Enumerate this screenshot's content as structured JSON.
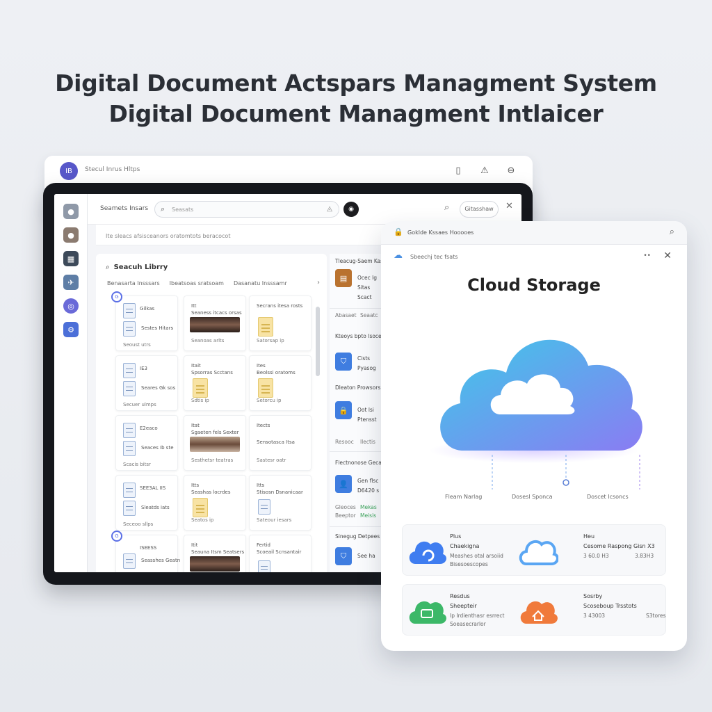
{
  "headline": {
    "line1": "Digital Document Actspars Managment System",
    "line2": "Digital Document Managment Intlaicer"
  },
  "back_window": {
    "title": "Stecul Inrus Hltps",
    "logo_text": "IB",
    "icons": [
      "clipboard-icon",
      "warning-icon",
      "minus-circle-icon"
    ]
  },
  "tablet": {
    "topbar": {
      "label": "Seamets Insars",
      "search_placeholder": "Seasats",
      "button_label": "Gitasshaw"
    },
    "infobar_text": "Ite sleacs afsisceanors oratomtots beracocot",
    "library": {
      "title": "Seacuh Librry",
      "filters": [
        "Benasarta Insssars",
        "Ibeatsoas sratsoam",
        "Dasanatu Insssamr"
      ],
      "cards": [
        {
          "t1": "Gilkas",
          "t2": "Seoust utrs",
          "body": "Sestes Hitars"
        },
        {
          "t1": "Itt",
          "t1b": "Seaness itcacs orsas",
          "t2": "Seanoas arlts"
        },
        {
          "t1": "Secrans itesa rosts",
          "t2": "Satorsap ip"
        },
        {
          "t1": "IE3",
          "t2": "Secuer ulmps",
          "body": "Seares Gk sos"
        },
        {
          "t1": "Itait",
          "t1b": "Spsorras Scctans",
          "t2": "Sdtis ip"
        },
        {
          "t1": "Ites",
          "t1b": "Beolssi oratoms",
          "t2": "Setorcu ip"
        },
        {
          "t1": "E2eaco",
          "t2": "Scacis bitsr",
          "body": "Seaces Ib ste"
        },
        {
          "t1": "Itat",
          "t1b": "Sgaeten fels Sexter",
          "t2": "Sesthetsr teatras"
        },
        {
          "t1": "Itects",
          "t1b": "Sensotasca Itsa",
          "t2": "Sastesr oatr"
        },
        {
          "t1": "SEE3AL IIS",
          "t2": "Seceoo sllps",
          "body": "Sleatds iats"
        },
        {
          "t1": "Itts",
          "t1b": "Seashas locrdes",
          "t2": "Seatos ip"
        },
        {
          "t1": "Itts",
          "t1b": "Stisosn Dsnanicaar",
          "t2": "Sateour iesars"
        },
        {
          "t1": "ISEESS",
          "t2": "",
          "body": "Seasshes Geatn"
        },
        {
          "t1": "Itit",
          "t1b": "Seauna Itsm Seatsers",
          "t2": ""
        },
        {
          "t1": "Fertid",
          "t1b": "Scoeail Scnsantair",
          "t2": ""
        }
      ]
    },
    "mid_panel": {
      "rows": [
        "Tleacug-Saem Kas",
        "Ocec lg",
        "Sitas",
        "Scact",
        "Abasaet",
        "Seaatc",
        "Kteoys bpto Isoce.",
        "Cists",
        "Pyasog",
        "Dleaton Prowsors",
        "Oot lsi",
        "Ptensst",
        "Resooc",
        "Ilectis",
        "Flectnonose Gecas",
        "Gen flsc",
        "D6420 s",
        "Gleoces",
        "Mekas",
        "Beeptor",
        "Meisis",
        "Sinegug Detpees",
        "See ha"
      ]
    }
  },
  "cloud_panel": {
    "header_title": "Goklde Kssaes Hooooes",
    "sub_title": "Sbeechj tec fsats",
    "sub_dots": "••",
    "title": "Cloud Storage",
    "flow_labels": [
      "Fleam Narlag",
      "Dosesl Sponca",
      "Doscet Icsoncs"
    ],
    "tiles": [
      {
        "a": "Plus",
        "b": "Chaekigna",
        "c": "Meashes otal arsoiid",
        "d": "Bisesoescopes",
        "icon": "sync-cloud-icon",
        "color": "#3f7df0"
      },
      {
        "a": "Heu",
        "b": "Cesome Raspong Gisn X3",
        "c": "3 60.0 H3",
        "e": "3.83H3",
        "icon": "cloud-outline-icon",
        "color": "#5aa6f3"
      },
      {
        "a": "Resdus",
        "b": "Sheepteir",
        "c": "Ip Irdienthasr esrrect",
        "d": "Soeasecrarlor",
        "icon": "chat-cloud-icon",
        "color": "#3cb868"
      },
      {
        "a": "Sosrby",
        "b": "Scoseboup Trsstots",
        "c": "3 43003",
        "e": "S3tores",
        "icon": "home-cloud-icon",
        "color": "#f07a3b"
      }
    ]
  },
  "colors": {
    "accent": "#5b6fe6",
    "cloud_gradient_start": "#3ec9e8",
    "cloud_gradient_end": "#8a7cf3"
  }
}
